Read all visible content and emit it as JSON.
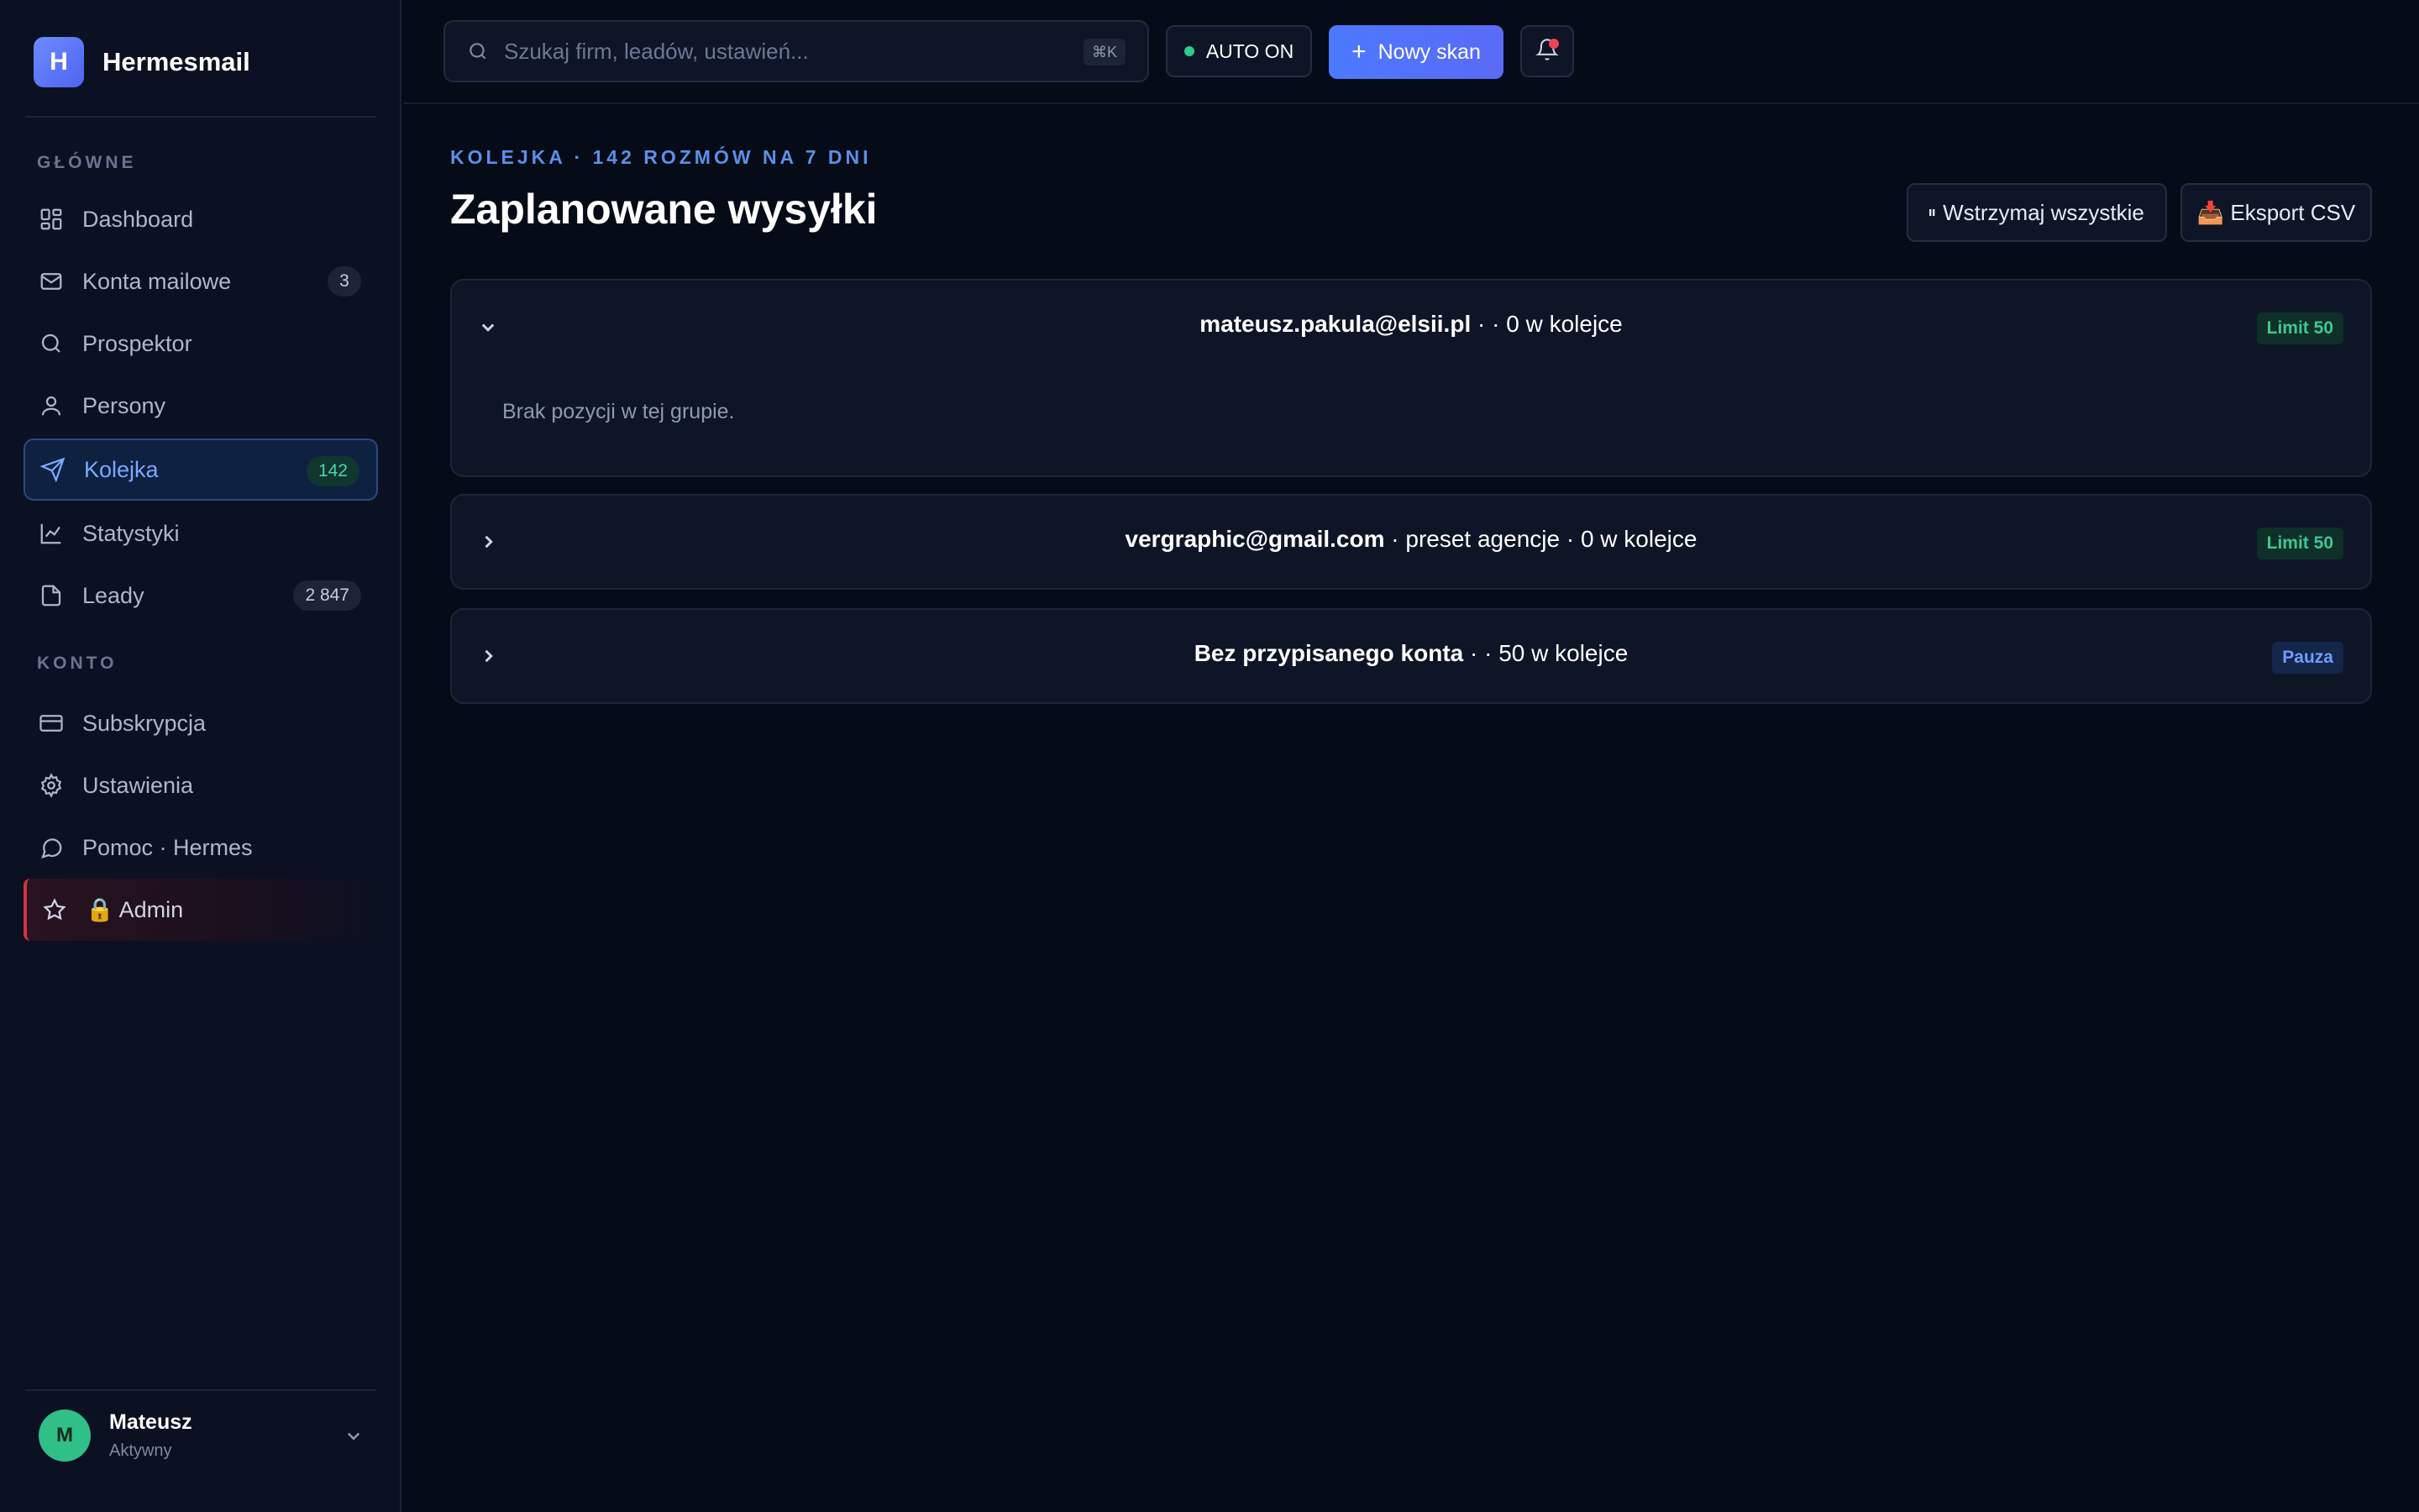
{
  "brand": {
    "logo_letter": "H",
    "name": "Hermesmail"
  },
  "sidebar": {
    "section_main": "GŁÓWNE",
    "section_account": "KONTO",
    "items": [
      {
        "label": "Dashboard",
        "icon": "grid-icon"
      },
      {
        "label": "Konta mailowe",
        "icon": "mail-icon",
        "count": "3"
      },
      {
        "label": "Prospektor",
        "icon": "search-icon"
      },
      {
        "label": "Persony",
        "icon": "user-icon"
      },
      {
        "label": "Kolejka",
        "icon": "send-icon",
        "count": "142",
        "active": true
      },
      {
        "label": "Statystyki",
        "icon": "chart-icon"
      },
      {
        "label": "Leady",
        "icon": "file-icon",
        "count": "2 847"
      },
      {
        "label": "Subskrypcja",
        "icon": "card-icon"
      },
      {
        "label": "Ustawienia",
        "icon": "gear-icon"
      },
      {
        "label": "Pomoc · Hermes",
        "icon": "chat-icon"
      },
      {
        "label": "🔒 Admin",
        "icon": "star-icon"
      }
    ]
  },
  "user": {
    "initial": "M",
    "name": "Mateusz",
    "status": "Aktywny"
  },
  "topbar": {
    "search_placeholder": "Szukaj firm, leadów, ustawień...",
    "search_shortcut": "⌘K",
    "auto_label": "AUTO ON",
    "new_scan_label": "Nowy skan"
  },
  "header": {
    "eyebrow": "KOLEJKA · 142 ROZMÓW NA 7 DNI",
    "title": "Zaplanowane wysyłki",
    "pause_all_label": "Wstrzymaj wszystkie",
    "export_label": "📥 Eksport CSV"
  },
  "groups": [
    {
      "account": "mateusz.pakula@elsii.pl",
      "rest": " · · 0 w kolejce",
      "badge": "Limit 50",
      "expanded": true,
      "empty_text": "Brak pozycji w tej grupie."
    },
    {
      "account": "vergraphic@gmail.com",
      "rest": " · preset agencje · 0 w kolejce",
      "badge": "Limit 50",
      "expanded": false
    },
    {
      "account": "Bez przypisanego konta",
      "rest": " · · 50 w kolejce",
      "badge": "Pauza",
      "expanded": false
    }
  ],
  "colors": {
    "accent": "#4b79ff",
    "active_nav": "#7aa8ff",
    "success": "#2ecc8a",
    "danger": "#ef4452"
  }
}
